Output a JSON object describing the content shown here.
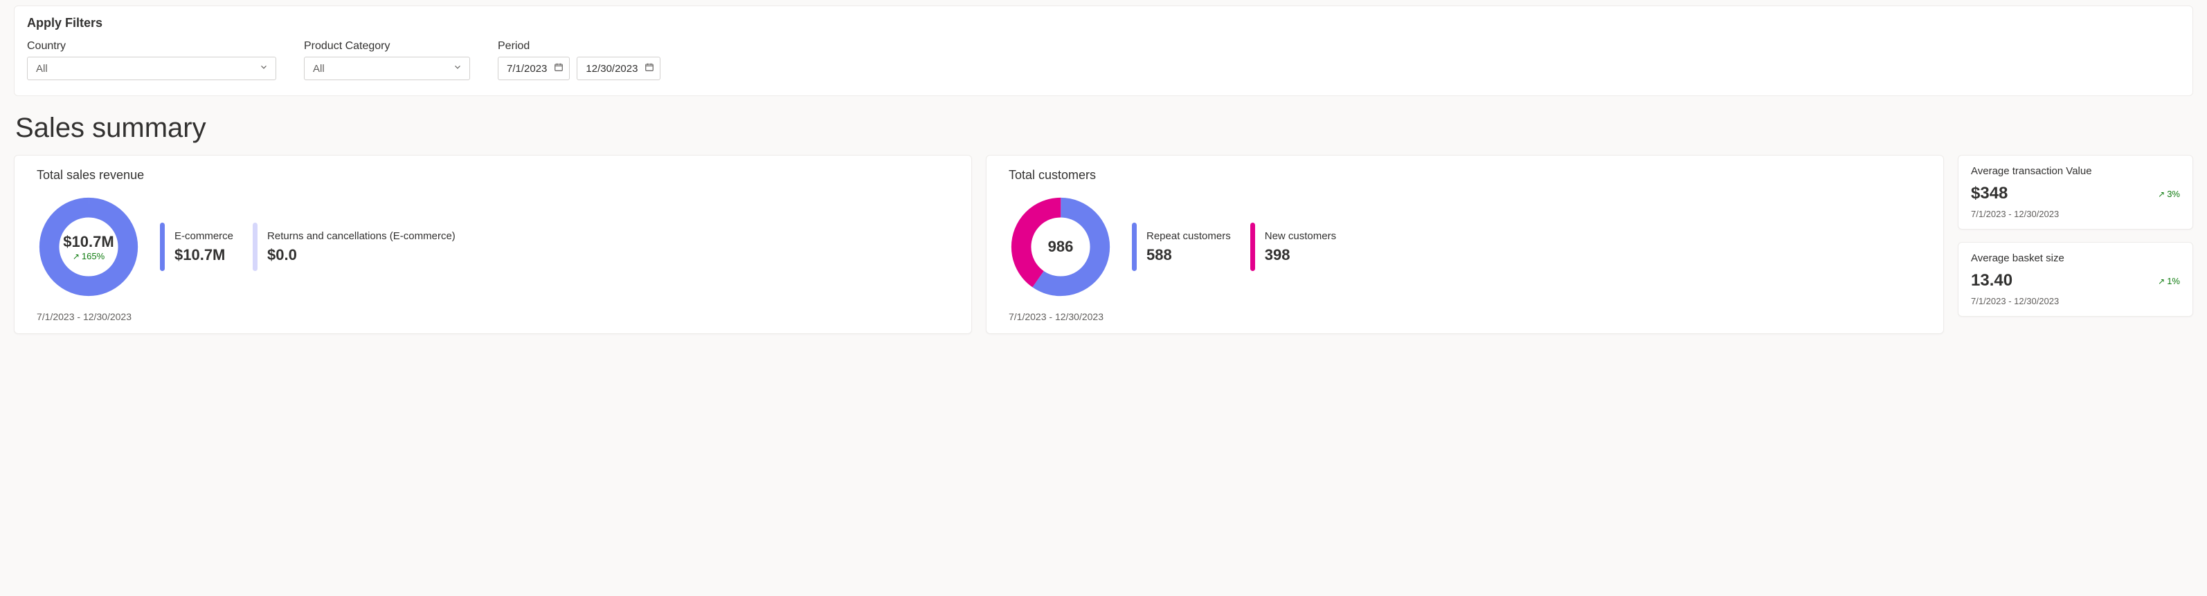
{
  "filters": {
    "title": "Apply Filters",
    "country": {
      "label": "Country",
      "value": "All"
    },
    "category": {
      "label": "Product Category",
      "value": "All"
    },
    "period": {
      "label": "Period",
      "start": "7/1/2023",
      "end": "12/30/2023"
    }
  },
  "pageTitle": "Sales summary",
  "revenueCard": {
    "title": "Total sales revenue",
    "donutValue": "$10.7M",
    "delta": "165%",
    "ecommerce": {
      "label": "E-commerce",
      "value": "$10.7M"
    },
    "returns": {
      "label": "Returns and cancellations (E-commerce)",
      "value": "$0.0"
    },
    "range": "7/1/2023 - 12/30/2023"
  },
  "customersCard": {
    "title": "Total customers",
    "donutValue": "986",
    "repeat": {
      "label": "Repeat customers",
      "value": "588"
    },
    "new": {
      "label": "New customers",
      "value": "398"
    },
    "range": "7/1/2023 - 12/30/2023"
  },
  "avgTransaction": {
    "title": "Average transaction Value",
    "value": "$348",
    "delta": "3%",
    "range": "7/1/2023 - 12/30/2023"
  },
  "avgBasket": {
    "title": "Average basket size",
    "value": "13.40",
    "delta": "1%",
    "range": "7/1/2023 - 12/30/2023"
  },
  "colors": {
    "primary": "#6b7ff0",
    "primaryLight": "#d6d7fb",
    "magenta": "#e3008c",
    "green": "#107c10"
  },
  "chart_data": [
    {
      "type": "pie",
      "title": "Total sales revenue",
      "series": [
        {
          "name": "E-commerce",
          "value": 10700000,
          "color": "#6b7ff0"
        },
        {
          "name": "Returns and cancellations (E-commerce)",
          "value": 0,
          "color": "#d6d7fb"
        }
      ],
      "total_label": "$10.7M",
      "delta_pct": 165
    },
    {
      "type": "pie",
      "title": "Total customers",
      "series": [
        {
          "name": "Repeat customers",
          "value": 588,
          "color": "#6b7ff0"
        },
        {
          "name": "New customers",
          "value": 398,
          "color": "#e3008c"
        }
      ],
      "total_label": "986"
    }
  ]
}
